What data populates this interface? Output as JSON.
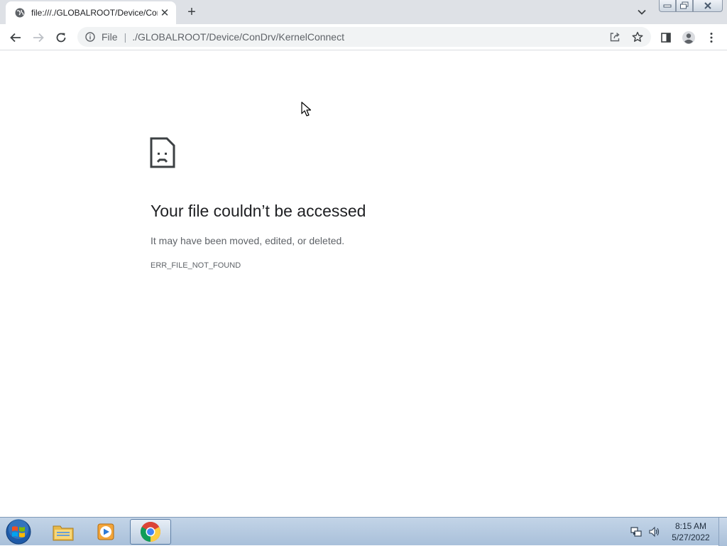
{
  "browser": {
    "tab": {
      "title": "file:///./GLOBALROOT/Device/ConDrv/KernelConnect",
      "close_glyph": "✕",
      "favicon": "globe-icon"
    },
    "new_tab_glyph": "+",
    "toolbar": {
      "omnibox": {
        "scheme": "File",
        "separator": "|",
        "url": "./GLOBALROOT/Device/ConDrv/KernelConnect"
      }
    }
  },
  "page": {
    "title": "Your file couldn’t be accessed",
    "description": "It may have been moved, edited, or deleted.",
    "error_code": "ERR_FILE_NOT_FOUND"
  },
  "taskbar": {
    "pinned": [
      "windows-explorer",
      "media-player",
      "chrome"
    ],
    "clock": {
      "time": "8:15 AM",
      "date": "5/27/2022"
    }
  },
  "colors": {
    "accent": "#1a73e8",
    "text": "#202124",
    "muted": "#5f6368",
    "tabstrip": "#dee1e6"
  }
}
